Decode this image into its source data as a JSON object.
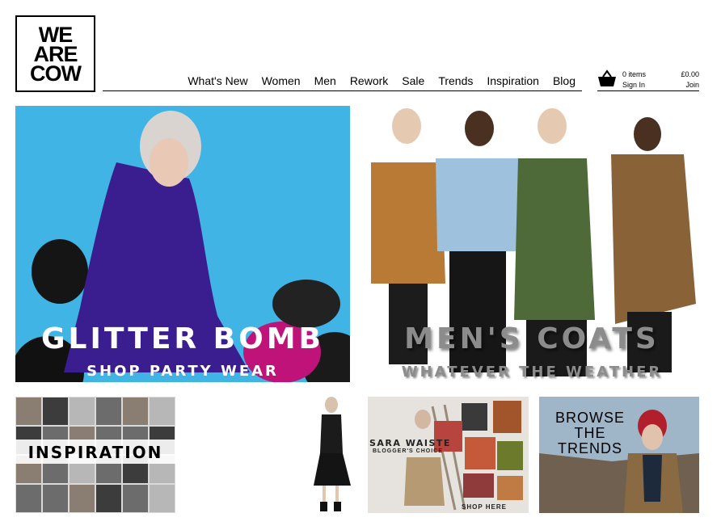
{
  "logo": {
    "lines": [
      "WE",
      "ARE",
      "COW"
    ]
  },
  "nav": {
    "items": [
      {
        "label": "What's New"
      },
      {
        "label": "Women"
      },
      {
        "label": "Men"
      },
      {
        "label": "Rework"
      },
      {
        "label": "Sale"
      },
      {
        "label": "Trends"
      },
      {
        "label": "Inspiration"
      },
      {
        "label": "Blog"
      }
    ]
  },
  "account": {
    "items": "0 items",
    "sign_in": "Sign In",
    "total": "£0.00",
    "join": "Join",
    "basket_icon": "shopping-basket-icon"
  },
  "banners": {
    "glitter": {
      "title": "GLITTER BOMB",
      "subtitle": "SHOP PARTY WEAR",
      "bg": "#3fb4e5"
    },
    "coats": {
      "title": "MEN'S COATS",
      "subtitle": "WHATEVER THE WEATHER",
      "text_color": "#8c8c8c"
    }
  },
  "tiles": {
    "inspiration": {
      "label": "INSPIRATION"
    },
    "sara": {
      "title": "SARA WAISTE",
      "subtitle": "BLOGGER'S CHOICE",
      "cta": "SHOP HERE"
    },
    "trends": {
      "title": "BROWSE THE TRENDS"
    }
  }
}
